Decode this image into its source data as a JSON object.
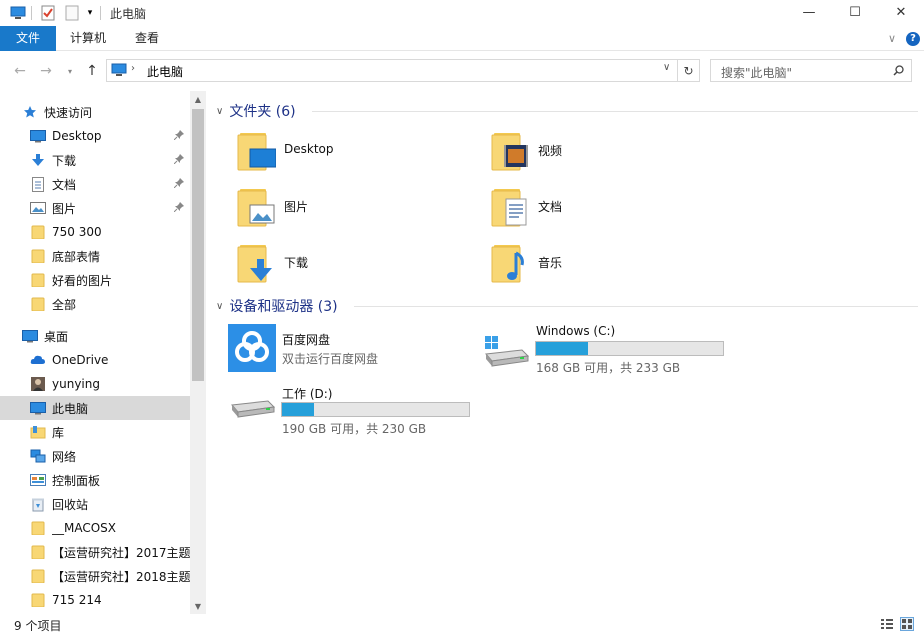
{
  "window": {
    "title": "此电脑",
    "minimize_icon": "—",
    "maximize_icon": "☐",
    "close_icon": "✕"
  },
  "ribbon": {
    "tabs": [
      "文件",
      "计算机",
      "查看"
    ],
    "collapse_icon": "∨",
    "help_icon": "?"
  },
  "address": {
    "path": "此电脑",
    "search_placeholder": "搜索\"此电脑\""
  },
  "sidebar": {
    "items": [
      {
        "label": "快速访问",
        "icon": "star-icon"
      },
      {
        "label": "Desktop",
        "icon": "desktop-icon",
        "pinned": true
      },
      {
        "label": "下载",
        "icon": "download-icon",
        "pinned": true
      },
      {
        "label": "文档",
        "icon": "document-icon",
        "pinned": true
      },
      {
        "label": "图片",
        "icon": "picture-icon",
        "pinned": true
      },
      {
        "label": "750 300",
        "icon": "folder-icon"
      },
      {
        "label": "底部表情",
        "icon": "folder-icon"
      },
      {
        "label": "好看的图片",
        "icon": "folder-icon"
      },
      {
        "label": "全部",
        "icon": "folder-icon"
      },
      {
        "label": "桌面",
        "icon": "desktop-icon"
      },
      {
        "label": "OneDrive",
        "icon": "cloud-icon"
      },
      {
        "label": "yunying",
        "icon": "user-icon"
      },
      {
        "label": "此电脑",
        "icon": "computer-icon",
        "selected": true
      },
      {
        "label": "库",
        "icon": "library-icon"
      },
      {
        "label": "网络",
        "icon": "network-icon"
      },
      {
        "label": "控制面板",
        "icon": "control-panel-icon"
      },
      {
        "label": "回收站",
        "icon": "recycle-bin-icon"
      },
      {
        "label": "__MACOSX",
        "icon": "folder-icon"
      },
      {
        "label": "【运营研究社】2017主题",
        "icon": "folder-icon"
      },
      {
        "label": "【运营研究社】2018主题",
        "icon": "folder-icon"
      },
      {
        "label": "715 214",
        "icon": "folder-icon"
      }
    ]
  },
  "main": {
    "folders_header": "文件夹 (6)",
    "folders": [
      {
        "label": "Desktop",
        "icon": "desktop-folder-icon"
      },
      {
        "label": "视频",
        "icon": "video-folder-icon"
      },
      {
        "label": "图片",
        "icon": "picture-folder-icon"
      },
      {
        "label": "文档",
        "icon": "document-folder-icon"
      },
      {
        "label": "下载",
        "icon": "download-folder-icon"
      },
      {
        "label": "音乐",
        "icon": "music-folder-icon"
      }
    ],
    "devices_header": "设备和驱动器 (3)",
    "devices": [
      {
        "name": "百度网盘",
        "sub": "双击运行百度网盘",
        "icon": "baidu-netdisk-icon"
      },
      {
        "name": "Windows (C:)",
        "sub": "168 GB 可用，共 233 GB",
        "icon": "windows-drive-icon",
        "used_fraction": 0.28
      },
      {
        "name": "工作 (D:)",
        "sub": "190 GB 可用，共 230 GB",
        "icon": "hard-drive-icon",
        "used_fraction": 0.17
      }
    ]
  },
  "status": {
    "count": "9 个项目"
  },
  "colors": {
    "accent": "#1979ca",
    "header_text": "#1e3287",
    "bar_fill": "#26a0da",
    "selection": "#d9d9d9"
  }
}
